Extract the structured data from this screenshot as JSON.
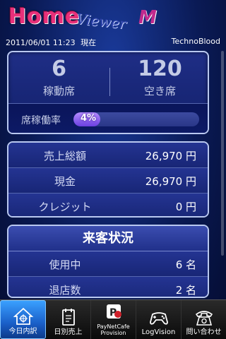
{
  "header": {
    "logo_home": "Home",
    "logo_viewer": "Viewer",
    "logo_m": "M",
    "datetime": "2011/06/01 11:23",
    "now_label": "現在",
    "shop_name": "TechnoBlood"
  },
  "seats": {
    "in_use_count": "6",
    "in_use_label": "稼動席",
    "empty_count": "120",
    "empty_label": "空き席",
    "rate_label": "席稼働率",
    "rate_text": "4%",
    "rate_value": 0.04
  },
  "sales": {
    "total_label": "売上総額",
    "total_value": "26,970 円",
    "cash_label": "現金",
    "cash_value": "26,970 円",
    "credit_label": "クレジット",
    "credit_value": "0 円"
  },
  "visitors": {
    "title": "来客状況",
    "in_use_label": "使用中",
    "in_use_value": "6 名",
    "left_label": "退店数",
    "left_value": "2 名"
  },
  "tabs": [
    {
      "label": "今日内訳",
      "icon": "house-icon",
      "active": true
    },
    {
      "label": "日別売上",
      "icon": "calendar-icon",
      "active": false
    },
    {
      "label": "PayNetCafe",
      "label2": "Provision",
      "icon": "paynetcafe-icon",
      "active": false
    },
    {
      "label": "LogVision",
      "icon": "gamepad-icon",
      "active": false
    },
    {
      "label": "問い合わせ",
      "icon": "telephone-icon",
      "active": false
    }
  ],
  "colors": {
    "background": "#0a1a55",
    "panel_border": "#b9c8f0",
    "logo_pink": "#e8307a",
    "rate_fill": "#8a5cf0",
    "active_tab": "#2a80e8"
  }
}
